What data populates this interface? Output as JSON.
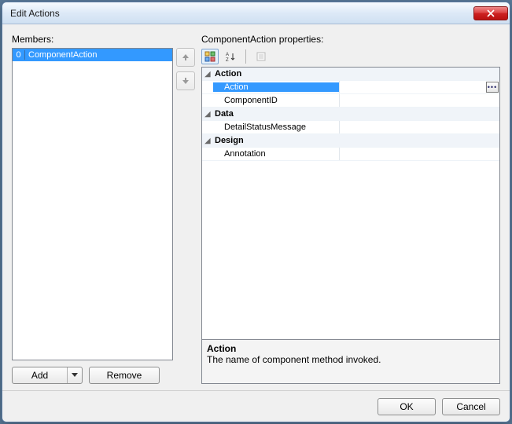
{
  "titlebar": {
    "title": "Edit Actions"
  },
  "members": {
    "label": "Members:",
    "items": [
      {
        "index": "0",
        "name": "ComponentAction",
        "selected": true
      }
    ]
  },
  "buttons": {
    "add": "Add",
    "remove": "Remove",
    "ok": "OK",
    "cancel": "Cancel"
  },
  "properties": {
    "label": "ComponentAction properties:",
    "categories": [
      {
        "name": "Action",
        "props": [
          {
            "name": "Action",
            "value": "",
            "selected": true,
            "hasEllipsis": true
          },
          {
            "name": "ComponentID",
            "value": ""
          }
        ]
      },
      {
        "name": "Data",
        "props": [
          {
            "name": "DetailStatusMessage",
            "value": ""
          }
        ]
      },
      {
        "name": "Design",
        "props": [
          {
            "name": "Annotation",
            "value": ""
          }
        ]
      }
    ],
    "help": {
      "title": "Action",
      "description": "The name of component method invoked."
    }
  }
}
